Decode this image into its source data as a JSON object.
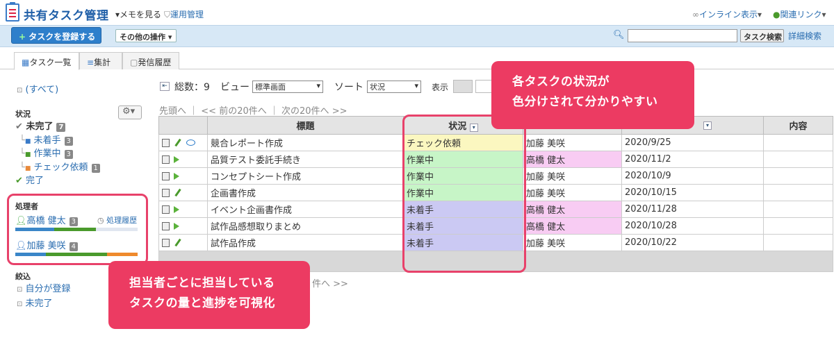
{
  "header": {
    "title": "共有タスク管理",
    "memo_label": "メモを見る",
    "admin_label": "運用管理",
    "inline_label": "インライン表示",
    "related_label": "関連リンク"
  },
  "toolbar": {
    "register_label": "タスクを登録する",
    "other_label": "その他の操作",
    "search_value": "",
    "search_button": "タスク検索",
    "advanced_label": "詳細検索"
  },
  "tabs": [
    {
      "label": "タスク一覧"
    },
    {
      "label": "集計"
    },
    {
      "label": "発信履歴"
    }
  ],
  "sidebar": {
    "all_label": "(すべて)",
    "status_heading": "状況",
    "status_items": [
      {
        "label": "未完了",
        "count": "7",
        "color": "#555555"
      },
      {
        "label": "未着手",
        "count": "3",
        "color": "#3a7bc8"
      },
      {
        "label": "作業中",
        "count": "3",
        "color": "#4a9a2c"
      },
      {
        "label": "チェック依頼",
        "count": "1",
        "color": "#e8893a"
      },
      {
        "label": "完了",
        "count": "",
        "color": "#4a9a2c"
      }
    ],
    "assignee_heading": "処理者",
    "history_label": "処理履歴",
    "assignees": [
      {
        "name": "高橋 健太",
        "count": "3",
        "progress": [
          {
            "color": "#3a86c8",
            "fraction": 0.32
          },
          {
            "color": "#4a9a2c",
            "fraction": 0.34
          },
          {
            "color": "#e0e6f0",
            "fraction": 0.34
          }
        ]
      },
      {
        "name": "加藤 美咲",
        "count": "4",
        "progress": [
          {
            "color": "#3a86c8",
            "fraction": 0.25
          },
          {
            "color": "#4a9a2c",
            "fraction": 0.5
          },
          {
            "color": "#ef8a2c",
            "fraction": 0.25
          }
        ]
      }
    ],
    "filter_heading": "絞込",
    "filter_items": [
      {
        "label": "自分が登録"
      },
      {
        "label": "未完了"
      }
    ]
  },
  "list": {
    "total_label": "総数：9",
    "view_label": "ビュー",
    "view_value": "標準画面",
    "sort_label": "ソート",
    "sort_value": "状況",
    "display_label": "表示",
    "pager_first": "先頭へ",
    "pager_prev": "<< 前の20件へ",
    "pager_next": "次の20件へ >>",
    "pager_next_bottom": "件へ >>",
    "columns": {
      "title": "標題",
      "status": "状況",
      "content": "内容"
    },
    "rows": [
      {
        "title": "競合レポート作成",
        "status": "チェック依頼",
        "status_class": "sYel",
        "assignee": "加藤 美咲",
        "pink": false,
        "date": "2020/9/25",
        "icon": "comment"
      },
      {
        "title": "品質テスト委託手続き",
        "status": "作業中",
        "status_class": "sGrn",
        "assignee": "高橋 健太",
        "pink": true,
        "date": "2020/11/2",
        "icon": "arrow"
      },
      {
        "title": "コンセプトシート作成",
        "status": "作業中",
        "status_class": "sGrn",
        "assignee": "加藤 美咲",
        "pink": false,
        "date": "2020/10/9",
        "icon": "arrow"
      },
      {
        "title": "企画書作成",
        "status": "作業中",
        "status_class": "sGrn",
        "assignee": "加藤 美咲",
        "pink": false,
        "date": "2020/10/15",
        "icon": "pen"
      },
      {
        "title": "イベント企画書作成",
        "status": "未着手",
        "status_class": "sBlu",
        "assignee": "高橋 健太",
        "pink": true,
        "date": "2020/11/28",
        "icon": "arrow"
      },
      {
        "title": "試作品感想取りまとめ",
        "status": "未着手",
        "status_class": "sBlu",
        "assignee": "高橋 健太",
        "pink": true,
        "date": "2020/10/28",
        "icon": "arrow"
      },
      {
        "title": "試作品作成",
        "status": "未着手",
        "status_class": "sBlu",
        "assignee": "加藤 美咲",
        "pink": false,
        "date": "2020/10/22",
        "icon": "pen"
      }
    ]
  },
  "callouts": {
    "status_line1": "各タスクの状況が",
    "status_line2": "色分けされて分かりやすい",
    "assignee_line1": "担当者ごとに担当している",
    "assignee_line2": "タスクの量と進捗を可視化"
  }
}
